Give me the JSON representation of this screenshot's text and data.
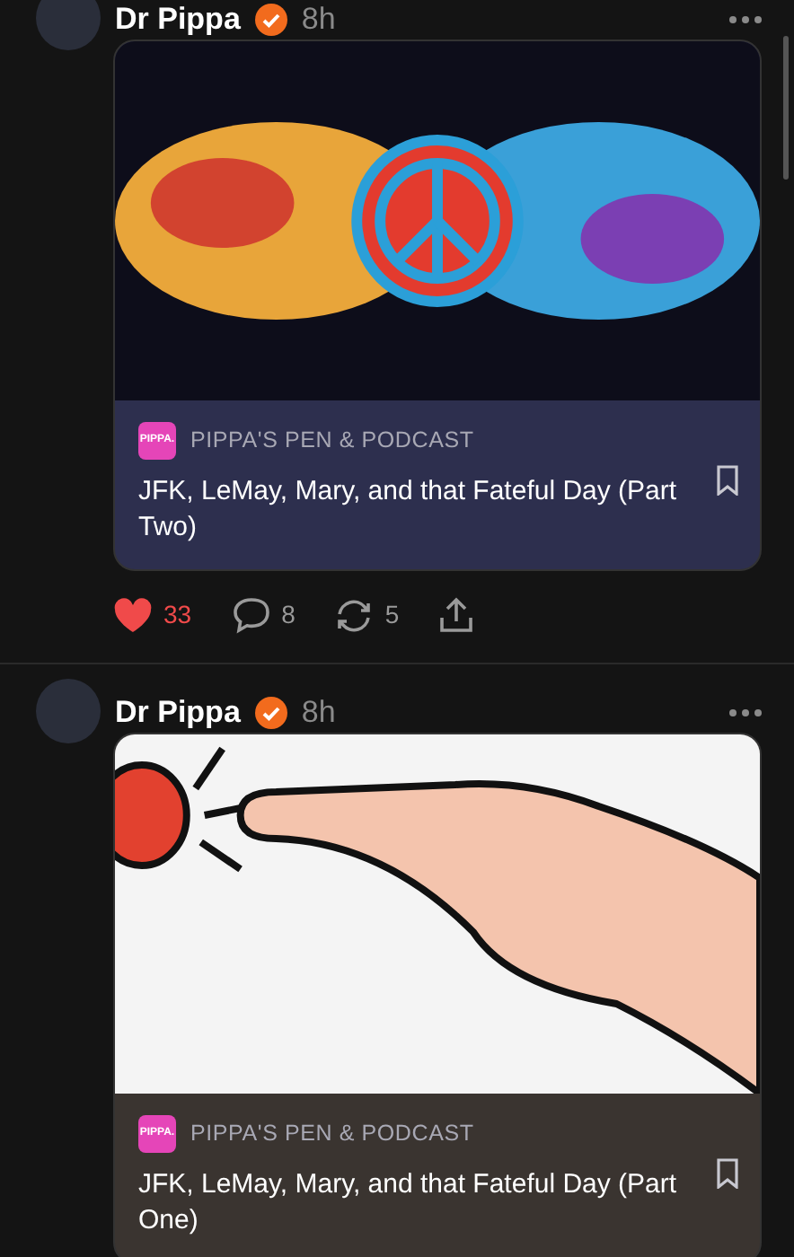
{
  "posts": [
    {
      "author": "Dr Pippa",
      "verified": true,
      "time": "8h",
      "kind": "peace",
      "card": {
        "logo_text": "PIPPA.",
        "publication": "PIPPA'S PEN & PODCAST",
        "title": "JFK, LeMay, Mary, and that Fateful Day (Part Two)",
        "color": "#2d2f4e"
      },
      "actions": {
        "liked": true,
        "likes": "33",
        "comments": "8",
        "restacks": "5"
      }
    },
    {
      "author": "Dr Pippa",
      "verified": true,
      "time": "8h",
      "kind": "hand",
      "card": {
        "logo_text": "PIPPA.",
        "publication": "PIPPA'S PEN & PODCAST",
        "title": "JFK, LeMay, Mary, and that Fateful Day (Part One)",
        "color": "#3a3430"
      }
    }
  ]
}
